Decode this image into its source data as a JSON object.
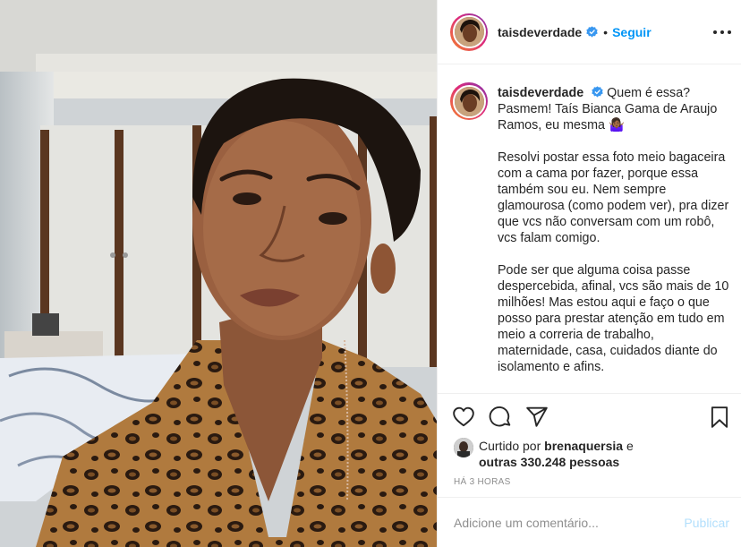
{
  "post": {
    "username": "taisdeverdade",
    "follow_dot": "•",
    "follow_label": "Seguir",
    "caption": {
      "username": "taisdeverdade",
      "line1": "Quem é essa? Pasmem! Taís Bianca Gama de Araujo Ramos, eu mesma 🤷🏾‍♀️",
      "paragraph2": "Resolvi postar essa foto meio bagaceira com a cama por fazer, porque essa também sou eu. Nem sempre glamourosa (como podem ver), pra dizer que vcs não conversam com um robô, vcs falam comigo.",
      "paragraph3": "Pode ser que alguma coisa passe despercebida, afinal, vcs são mais de 10 milhões! Mas estou aqui e faço o que posso para prestar atenção em tudo em meio a correria de trabalho, maternidade, casa, cuidados diante do isolamento e afins."
    },
    "likes": {
      "prefix": "Curtido por",
      "liker": "brenaquersia",
      "conjunction": "e",
      "others": "outras 330.248 pessoas"
    },
    "timestamp": "HÁ 3 HORAS",
    "comment": {
      "placeholder": "Adicione um comentário...",
      "publish_label": "Publicar"
    }
  },
  "icons": {
    "verified": "verified-badge-icon",
    "more": "more-options-icon",
    "like": "heart-icon",
    "comment": "comment-bubble-icon",
    "share": "paper-plane-icon",
    "save": "bookmark-icon"
  },
  "colors": {
    "accent": "#0095f6",
    "publish_disabled": "#b2dffc",
    "muted": "#8e8e8e",
    "border": "#efefef",
    "text": "#262626"
  }
}
